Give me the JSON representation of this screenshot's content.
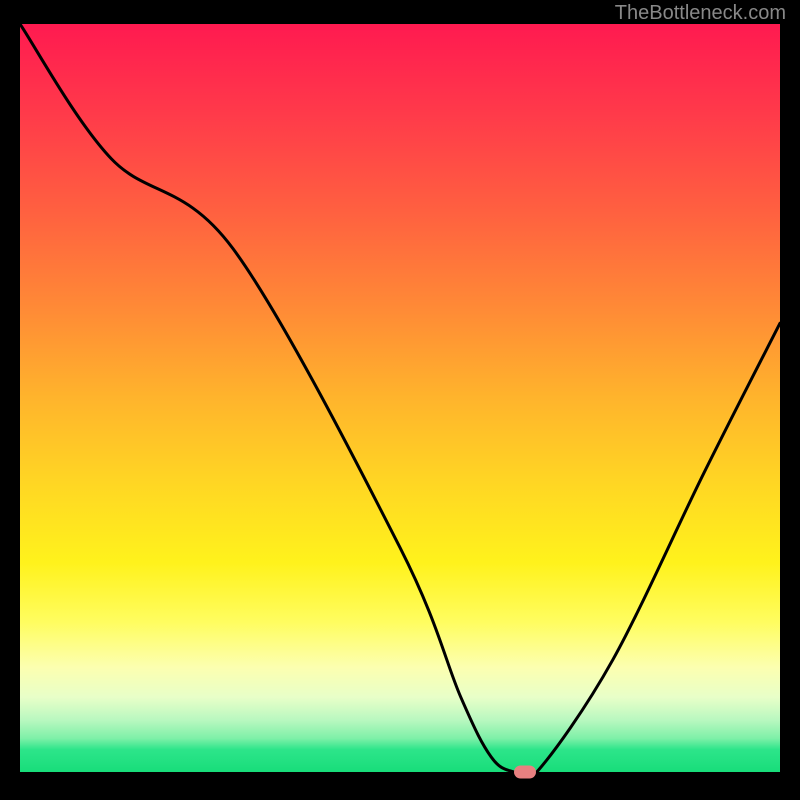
{
  "watermark": "TheBottleneck.com",
  "chart_data": {
    "type": "line",
    "title": "",
    "xlabel": "",
    "ylabel": "",
    "xlim": [
      0,
      100
    ],
    "ylim": [
      0,
      100
    ],
    "grid": false,
    "series": [
      {
        "name": "bottleneck-curve",
        "x": [
          0,
          12,
          28,
          50,
          58,
          62,
          65,
          68,
          78,
          90,
          100
        ],
        "y": [
          100,
          82,
          70,
          30,
          10,
          2,
          0,
          0,
          15,
          40,
          60
        ]
      }
    ],
    "marker": {
      "x": 66.5,
      "y": 0
    },
    "background": "red-to-green-vertical-gradient"
  }
}
